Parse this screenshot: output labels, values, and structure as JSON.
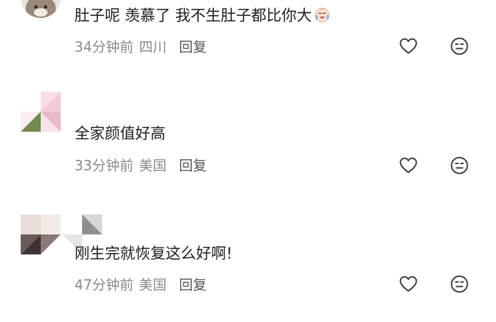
{
  "comments": [
    {
      "text": "肚子呢 羡慕了 我不生肚子都比你大",
      "emoji_icon": "crying-laughing-emoji",
      "time": "34分钟前",
      "location": "四川",
      "reply_label": "回复"
    },
    {
      "text": "全家颜值好高",
      "time": "33分钟前",
      "location": "美国",
      "reply_label": "回复"
    },
    {
      "text": "刚生完就恢复这么好啊!",
      "time": "47分钟前",
      "location": "美国",
      "reply_label": "回复"
    }
  ],
  "icons": {
    "like": "heart-outline-icon",
    "dislike": "neutral-face-icon"
  },
  "colors": {
    "text": "#1f1f1f",
    "meta": "#8a8a8a",
    "reply": "#555555",
    "icon": "#3a3a3a"
  }
}
